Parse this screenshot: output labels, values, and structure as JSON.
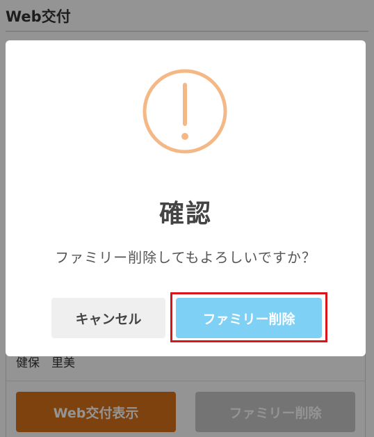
{
  "page": {
    "title": "Web交付",
    "member_name": "健保　里美",
    "web_issue_button": "Web交付表示",
    "family_delete_button": "ファミリー削除"
  },
  "modal": {
    "icon": "exclamation-circle-icon",
    "title": "確認",
    "message": "ファミリー削除してもよろしいですか？",
    "cancel_label": "キャンセル",
    "confirm_label": "ファミリー削除"
  },
  "colors": {
    "icon_color": "#f3b885",
    "confirm_button": "#7fd0f5",
    "web_button": "#d9731a",
    "highlight": "#d9141b"
  }
}
